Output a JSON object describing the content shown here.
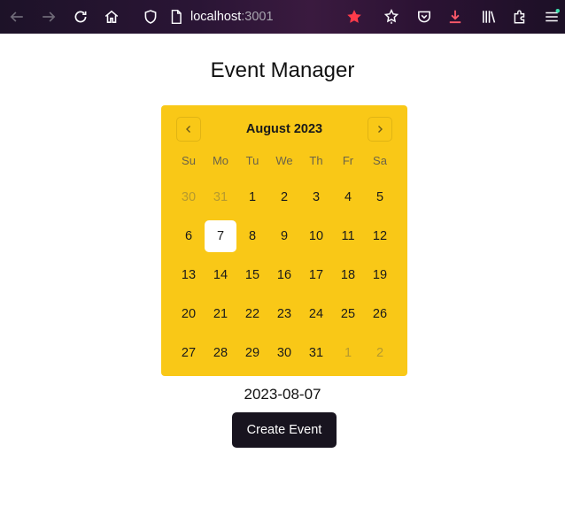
{
  "browser": {
    "url_host": "localhost",
    "url_port": ":3001",
    "icons": [
      "back-icon",
      "forward-icon",
      "reload-icon",
      "home-icon",
      "shield-icon",
      "page-icon",
      "bookmark-star-icon",
      "extensions-icon",
      "pocket-icon",
      "download-icon",
      "library-icon",
      "puzzle-icon",
      "menu-icon"
    ],
    "accent_star": "#ff3b4a",
    "accent_download": "#ff5a6a"
  },
  "page": {
    "title": "Event Manager",
    "selected_date_text": "2023-08-07",
    "create_button_label": "Create Event"
  },
  "calendar": {
    "month_label": "August 2023",
    "weekdays": [
      "Su",
      "Mo",
      "Tu",
      "We",
      "Th",
      "Fr",
      "Sa"
    ],
    "days": [
      {
        "label": "30",
        "outside": true
      },
      {
        "label": "31",
        "outside": true
      },
      {
        "label": "1"
      },
      {
        "label": "2"
      },
      {
        "label": "3"
      },
      {
        "label": "4"
      },
      {
        "label": "5"
      },
      {
        "label": "6"
      },
      {
        "label": "7",
        "selected": true
      },
      {
        "label": "8"
      },
      {
        "label": "9"
      },
      {
        "label": "10"
      },
      {
        "label": "11"
      },
      {
        "label": "12"
      },
      {
        "label": "13"
      },
      {
        "label": "14"
      },
      {
        "label": "15"
      },
      {
        "label": "16"
      },
      {
        "label": "17"
      },
      {
        "label": "18"
      },
      {
        "label": "19"
      },
      {
        "label": "20"
      },
      {
        "label": "21"
      },
      {
        "label": "22"
      },
      {
        "label": "23"
      },
      {
        "label": "24"
      },
      {
        "label": "25"
      },
      {
        "label": "26"
      },
      {
        "label": "27"
      },
      {
        "label": "28"
      },
      {
        "label": "29"
      },
      {
        "label": "30"
      },
      {
        "label": "31"
      },
      {
        "label": "1",
        "outside": true
      },
      {
        "label": "2",
        "outside": true
      }
    ],
    "background_color": "#f9c817"
  }
}
